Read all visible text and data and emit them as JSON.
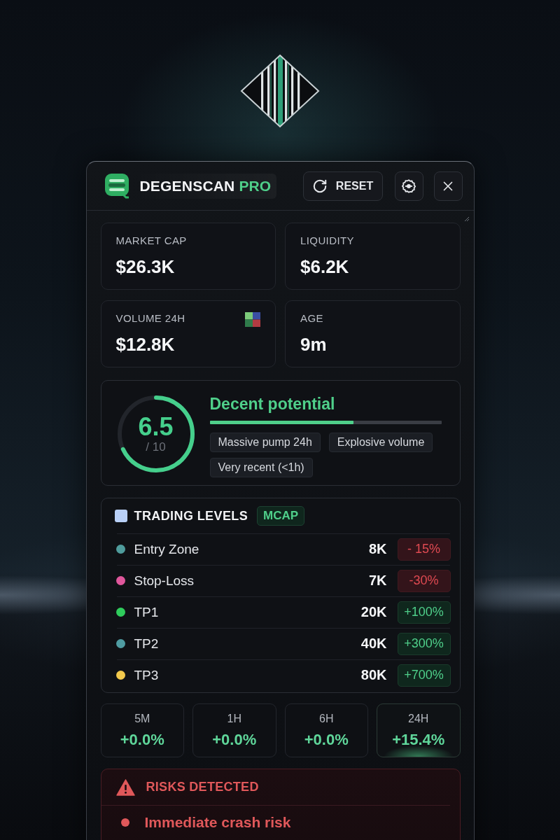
{
  "header": {
    "brand": "DEGENSCAN",
    "brand_suffix": "PRO",
    "reset_button": "RESET"
  },
  "stats": [
    {
      "label": "MARKET CAP",
      "value": "$26.3K",
      "kind": "plain"
    },
    {
      "label": "LIQUIDITY",
      "value": "$6.2K",
      "kind": "plain"
    },
    {
      "label": "VOLUME 24H",
      "value": "$12.8K",
      "kind": "icon"
    },
    {
      "label": "AGE",
      "value": "9m",
      "kind": "plain"
    }
  ],
  "score": {
    "value": "6.5",
    "scale": "/ 10",
    "ring": {
      "level": 0.68
    },
    "title": "Decent potential",
    "bar": {
      "level": 0.62
    },
    "tags": [
      "Massive pump 24h",
      "Explosive volume",
      "Very recent (<1h)"
    ]
  },
  "trading_levels": {
    "title": "TRADING LEVELS",
    "badge": "MCAP",
    "rows": [
      {
        "name": "Entry Zone",
        "color": "#4f9c9c",
        "value": "8K",
        "change": "- 15%",
        "kind": "loss"
      },
      {
        "name": "Stop-Loss",
        "color": "#e0579c",
        "value": "7K",
        "change": "-30%",
        "kind": "loss"
      },
      {
        "name": "TP1",
        "color": "#2fcc5c",
        "value": "20K",
        "change": "+100%",
        "kind": "gain"
      },
      {
        "name": "TP2",
        "color": "#4f9ca2",
        "value": "40K",
        "change": "+300%",
        "kind": "gain"
      },
      {
        "name": "TP3",
        "color": "#f2c94c",
        "value": "80K",
        "change": "+700%",
        "kind": "gain"
      }
    ]
  },
  "timeframes": [
    {
      "label": "5M",
      "value": "+0.0%",
      "selected": false
    },
    {
      "label": "1H",
      "value": "+0.0%",
      "selected": false
    },
    {
      "label": "6H",
      "value": "+0.0%",
      "selected": false
    },
    {
      "label": "24H",
      "value": "+15.4%",
      "selected": true
    }
  ],
  "risks": {
    "title": "RISKS DETECTED",
    "items": [
      "Immediate crash risk"
    ]
  }
}
